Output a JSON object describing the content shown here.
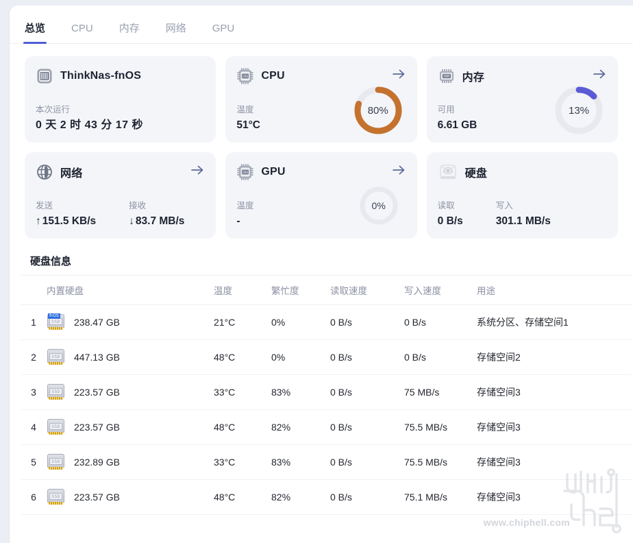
{
  "tabs": [
    {
      "label": "总览",
      "name": "tab-overview",
      "active": true
    },
    {
      "label": "CPU",
      "name": "tab-cpu",
      "active": false
    },
    {
      "label": "内存",
      "name": "tab-memory",
      "active": false
    },
    {
      "label": "网络",
      "name": "tab-network",
      "active": false
    },
    {
      "label": "GPU",
      "name": "tab-gpu",
      "active": false
    }
  ],
  "colors": {
    "accent": "#4f5ed6",
    "cpu_arc": "#c4722e",
    "memory_arc": "#5b5bd6",
    "track": "#e8e9ef",
    "busy_hot": "#e08030",
    "card_bg": "#f4f5f9"
  },
  "cards": {
    "host": {
      "icon": "nas-icon",
      "title": "ThinkNas-fnOS",
      "has_arrow": false,
      "metrics": [
        {
          "label": "本次运行",
          "value": "0 天 2 时 43 分 17 秒"
        }
      ]
    },
    "cpu": {
      "icon": "cpu-icon",
      "title": "CPU",
      "has_arrow": true,
      "metrics": [
        {
          "label": "温度",
          "value": "51°C"
        }
      ],
      "gauge": {
        "percent_label": "80%",
        "percent": 80,
        "color": "#c4722e"
      }
    },
    "memory": {
      "icon": "ram-icon",
      "title": "内存",
      "has_arrow": true,
      "metrics": [
        {
          "label": "可用",
          "value": "6.61 GB"
        }
      ],
      "gauge": {
        "percent_label": "13%",
        "percent": 13,
        "color": "#5b5bd6"
      }
    },
    "network": {
      "icon": "globe-icon",
      "title": "网络",
      "has_arrow": true,
      "metrics": [
        {
          "label": "发送",
          "dir": "↑",
          "value": "151.5 KB/s"
        },
        {
          "label": "接收",
          "dir": "↓",
          "value": "83.7 MB/s"
        }
      ]
    },
    "gpu": {
      "icon": "gpu-icon",
      "title": "GPU",
      "has_arrow": true,
      "metrics": [
        {
          "label": "温度",
          "value": "-"
        }
      ],
      "gauge": {
        "percent_label": "0%",
        "percent": 0,
        "color": "#e8e9ef"
      }
    },
    "disk": {
      "icon": "hdd-icon",
      "title": "硬盘",
      "has_arrow": false,
      "metrics": [
        {
          "label": "读取",
          "value": "0 B/s"
        },
        {
          "label": "写入",
          "value": "301.1 MB/s"
        }
      ]
    }
  },
  "disk_table": {
    "title": "硬盘信息",
    "headers": [
      "",
      "内置硬盘",
      "温度",
      "繁忙度",
      "读取速度",
      "写入速度",
      "用途"
    ],
    "rows": [
      {
        "index": "1",
        "icon": "ssd-fnos-icon",
        "badge": "fnOS",
        "capacity": "238.47 GB",
        "temp": "21°C",
        "busy": "0%",
        "busy_hot": false,
        "read": "0 B/s",
        "write": "0 B/s",
        "use": "系统分区、存储空间1"
      },
      {
        "index": "2",
        "icon": "ssd-icon",
        "badge": "",
        "capacity": "447.13 GB",
        "temp": "48°C",
        "busy": "0%",
        "busy_hot": false,
        "read": "0 B/s",
        "write": "0 B/s",
        "use": "存储空间2"
      },
      {
        "index": "3",
        "icon": "ssd-icon",
        "badge": "",
        "capacity": "223.57 GB",
        "temp": "33°C",
        "busy": "83%",
        "busy_hot": true,
        "read": "0 B/s",
        "write": "75 MB/s",
        "use": "存储空间3"
      },
      {
        "index": "4",
        "icon": "ssd-icon",
        "badge": "",
        "capacity": "223.57 GB",
        "temp": "48°C",
        "busy": "82%",
        "busy_hot": true,
        "read": "0 B/s",
        "write": "75.5 MB/s",
        "use": "存储空间3"
      },
      {
        "index": "5",
        "icon": "ssd-icon",
        "badge": "",
        "capacity": "232.89 GB",
        "temp": "33°C",
        "busy": "83%",
        "busy_hot": true,
        "read": "0 B/s",
        "write": "75.5 MB/s",
        "use": "存储空间3"
      },
      {
        "index": "6",
        "icon": "ssd-icon",
        "badge": "",
        "capacity": "223.57 GB",
        "temp": "48°C",
        "busy": "82%",
        "busy_hot": true,
        "read": "0 B/s",
        "write": "75.1 MB/s",
        "use": "存储空间3"
      }
    ]
  },
  "watermark": {
    "url_text": "www.chiphell.com",
    "logo_text": "chiphell"
  }
}
